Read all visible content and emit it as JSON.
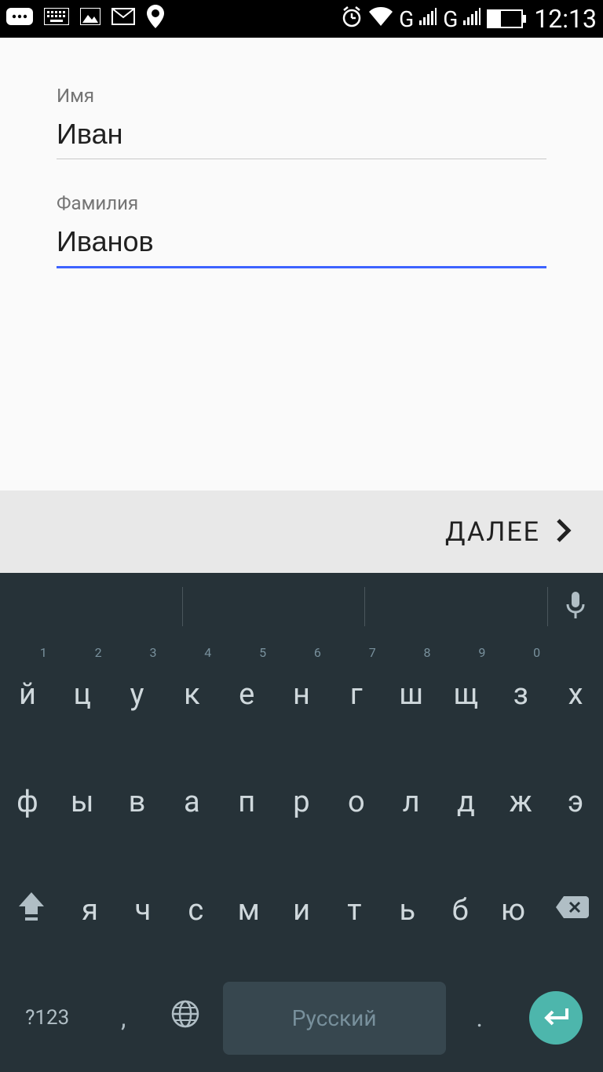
{
  "statusbar": {
    "battery_percent": "42",
    "time": "12:13",
    "signal1": "G",
    "signal2": "G"
  },
  "form": {
    "first_name_label": "Имя",
    "first_name_value": "Иван",
    "last_name_label": "Фамилия",
    "last_name_value": "Иванов"
  },
  "next_button": "ДАЛЕЕ",
  "keyboard": {
    "row1": [
      {
        "char": "й",
        "num": "1"
      },
      {
        "char": "ц",
        "num": "2"
      },
      {
        "char": "у",
        "num": "3"
      },
      {
        "char": "к",
        "num": "4"
      },
      {
        "char": "е",
        "num": "5"
      },
      {
        "char": "н",
        "num": "6"
      },
      {
        "char": "г",
        "num": "7"
      },
      {
        "char": "ш",
        "num": "8"
      },
      {
        "char": "щ",
        "num": "9"
      },
      {
        "char": "з",
        "num": "0"
      },
      {
        "char": "х",
        "num": ""
      }
    ],
    "row2": [
      "ф",
      "ы",
      "в",
      "а",
      "п",
      "р",
      "о",
      "л",
      "д",
      "ж",
      "э"
    ],
    "row3": [
      "я",
      "ч",
      "с",
      "м",
      "и",
      "т",
      "ь",
      "б",
      "ю"
    ],
    "symbols_key": "?123",
    "comma": ",",
    "period": ".",
    "space_label": "Русский"
  }
}
